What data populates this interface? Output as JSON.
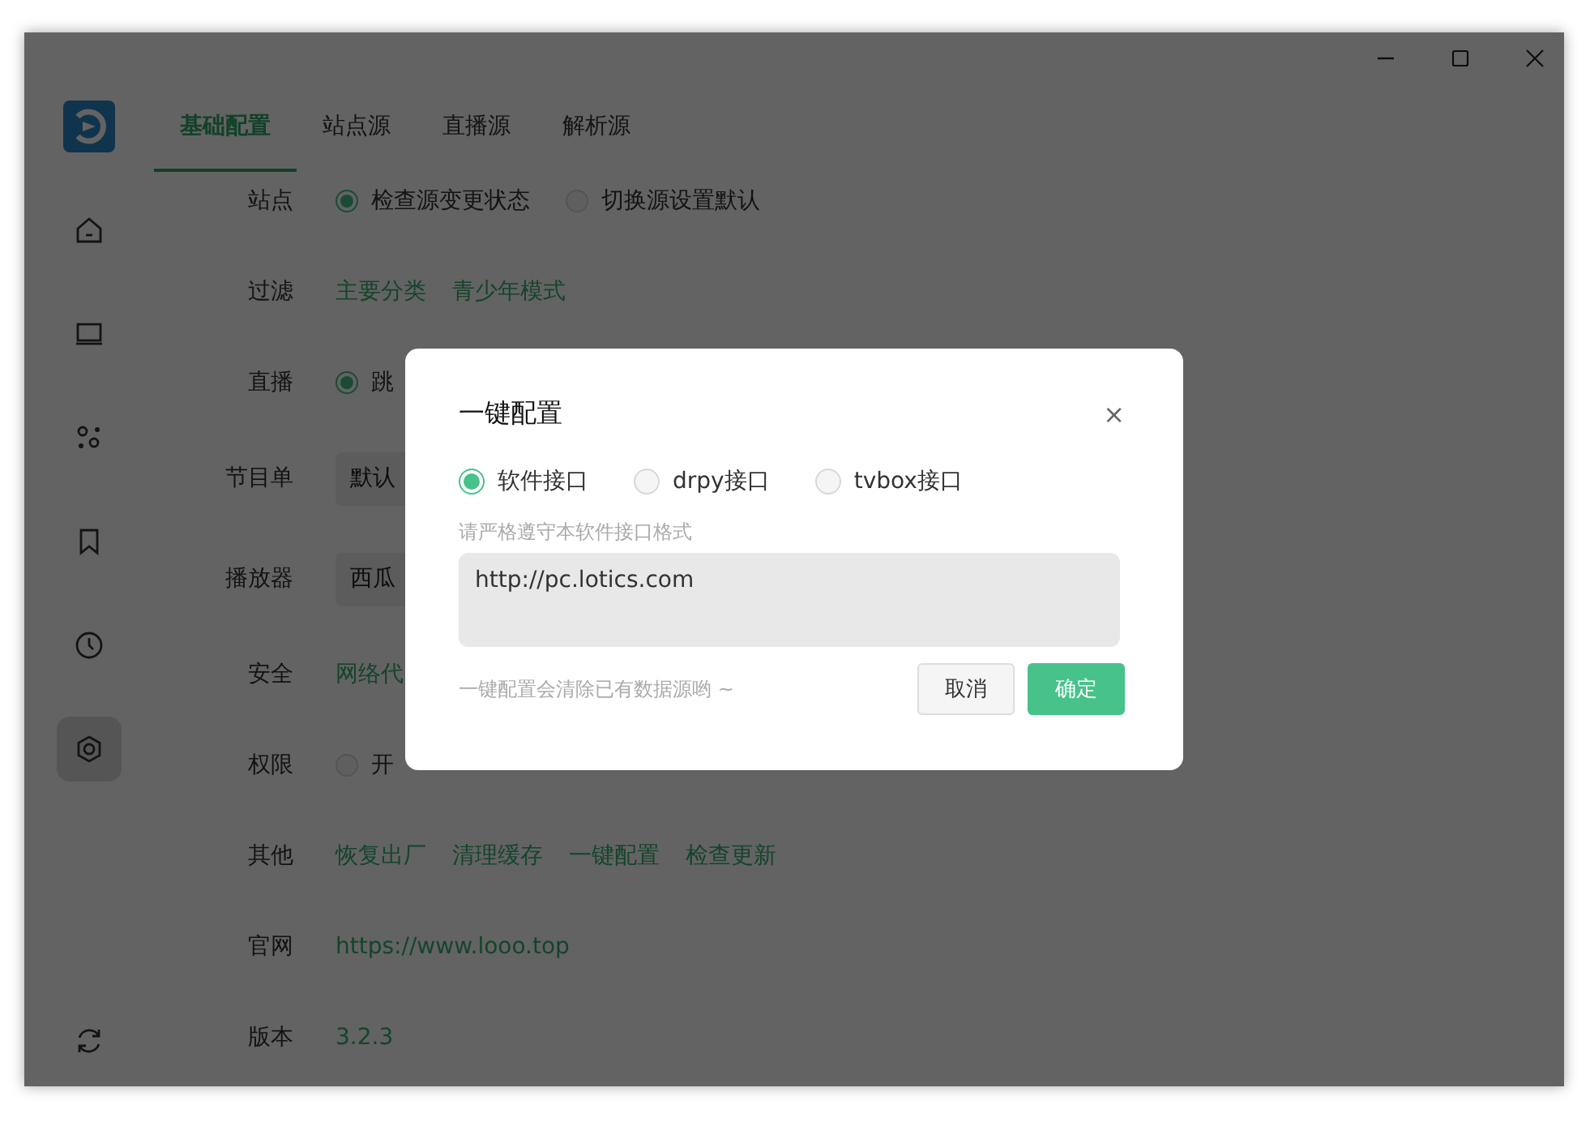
{
  "sidebar": {
    "items": [
      {
        "kind": "home",
        "selected": false
      },
      {
        "kind": "screen",
        "selected": false
      },
      {
        "kind": "people",
        "selected": false
      },
      {
        "kind": "bookmark",
        "selected": false
      },
      {
        "kind": "clock",
        "selected": false
      },
      {
        "kind": "settings",
        "selected": true
      }
    ]
  },
  "tabs": [
    {
      "label": "基础配置",
      "selected": true
    },
    {
      "label": "站点源",
      "selected": false
    },
    {
      "label": "直播源",
      "selected": false
    },
    {
      "label": "解析源",
      "selected": false
    }
  ],
  "settings": [
    {
      "label": "站点",
      "kind": "radios",
      "options": [
        {
          "label": "检查源变更状态",
          "selected": true
        },
        {
          "label": "切换源设置默认",
          "selected": false
        }
      ]
    },
    {
      "label": "过滤",
      "kind": "links",
      "links": [
        "主要分类",
        "青少年模式"
      ]
    },
    {
      "label": "直播",
      "kind": "radios",
      "options": [
        {
          "label": "跳",
          "selected": true
        }
      ]
    },
    {
      "label": "节目单",
      "kind": "select",
      "value": "默认"
    },
    {
      "label": "播放器",
      "kind": "select",
      "value": "西瓜"
    },
    {
      "label": "安全",
      "kind": "links",
      "links": [
        "网络代"
      ]
    },
    {
      "label": "权限",
      "kind": "radios",
      "options": [
        {
          "label": "开",
          "selected": false
        }
      ]
    },
    {
      "label": "其他",
      "kind": "links",
      "links": [
        "恢复出厂",
        "清理缓存",
        "一键配置",
        "检查更新"
      ]
    },
    {
      "label": "官网",
      "kind": "links",
      "links": [
        "https://www.looo.top"
      ]
    },
    {
      "label": "版本",
      "kind": "links",
      "links": [
        "3.2.3"
      ]
    }
  ],
  "dialog": {
    "title": "一键配置",
    "close": "×",
    "options": [
      {
        "label": "软件接口",
        "selected": true
      },
      {
        "label": "drpy接口",
        "selected": false
      },
      {
        "label": "tvbox接口",
        "selected": false
      }
    ],
    "hint": "请严格遵守本软件接口格式",
    "value": "http://pc.lotics.com",
    "note": "一键配置会清除已有数据源哟 ~",
    "buttons": [
      {
        "label": "取消",
        "kind": "secondary"
      },
      {
        "label": "确定",
        "kind": "primary"
      }
    ]
  }
}
